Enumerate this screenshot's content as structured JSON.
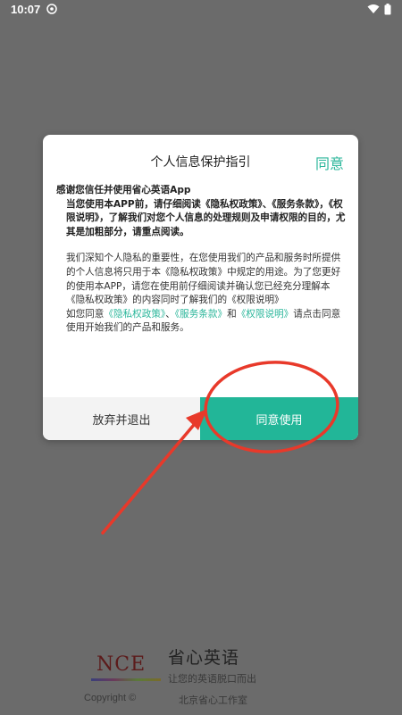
{
  "status_bar": {
    "time": "10:07"
  },
  "dialog": {
    "title": "个人信息保护指引",
    "agree_link": "同意",
    "intro_line1": "感谢您信任并使用省心英语App",
    "intro_line2": "当您使用本APP前，请仔细阅读《隐私权政策》、《服务条款》，《权限说明》，了解我们对您个人信息的处理规则及申请权限的目的，尤其是加粗部分，请重点阅读。",
    "para2": "我们深知个人隐私的重要性，在您使用我们的产品和服务时所提供的个人信息将只用于本《隐私权政策》中规定的用途。为了您更好的使用本APP，请您在使用前仔细阅读并确认您已经充分理解本《隐私权政策》的内容同时了解我们的《权限说明》",
    "para3_prefix": "如您同意",
    "privacy_link": "《隐私权政策》",
    "sep1": "、",
    "terms_link": "《服务条款》",
    "sep2": "和",
    "permission_link": "《权限说明》",
    "para3_suffix": "请点击同意使用开始我们的产品和服务。",
    "decline_button": "放弃并退出",
    "accept_button": "同意使用"
  },
  "brand": {
    "logo_text": "NCE",
    "name": "省心英语",
    "slogan": "让您的英语脱口而出",
    "copyright": "Copyright ©",
    "company": "北京省心工作室"
  },
  "colors": {
    "accent": "#22b698",
    "annotation": "#e8392a",
    "overlay": "#6b6b6b"
  }
}
